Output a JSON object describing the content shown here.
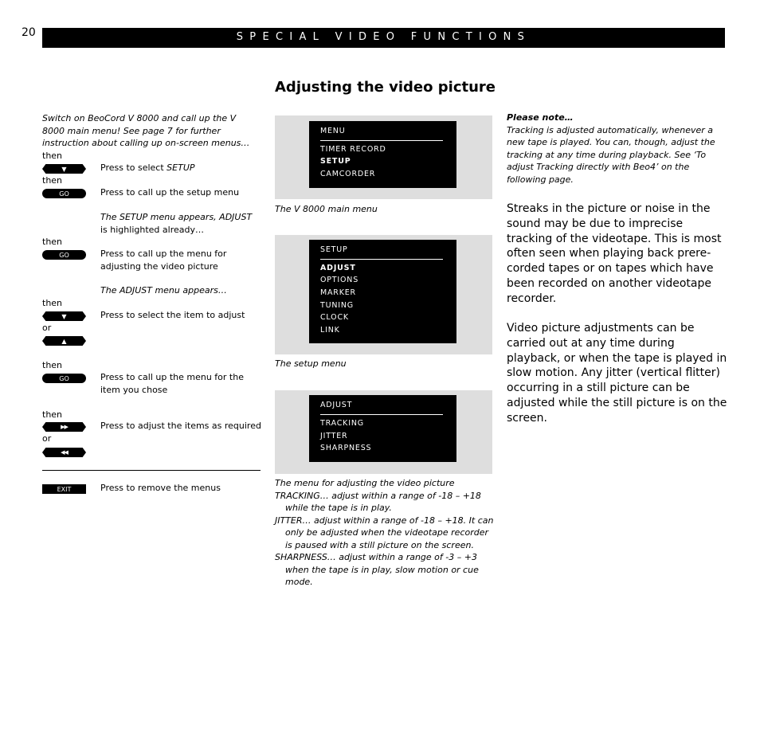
{
  "header": {
    "page_number": "20",
    "section_title": "SPECIAL VIDEO FUNCTIONS"
  },
  "title": "Adjusting the video picture",
  "instructions": {
    "intro": "Switch on BeoCord V 8000 and call up the V 8000 main menu! See page 7 for further instruction about calling up on-screen menus…",
    "connectors": {
      "then": "then",
      "or": "or"
    },
    "steps": [
      {
        "button": "down-arrow",
        "button_label": "▼",
        "text_prefix": "Press to select ",
        "text_italic": "SETUP"
      },
      {
        "button": "go",
        "button_label": "GO",
        "text": "Press to call up the setup menu"
      },
      {
        "note_italic_1": "The SETUP menu appears, ",
        "note_italic_2": "ADJUST",
        "note_rest": " is highlighted already…"
      },
      {
        "button": "go",
        "button_label": "GO",
        "text": "Press to call up the menu for adjusting the video picture"
      },
      {
        "note": "The ADJUST menu appears…"
      },
      {
        "button": "down-arrow",
        "button_label": "▼",
        "text": "Press to select the item to adjust"
      },
      {
        "button": "up-arrow",
        "button_label": "▲"
      },
      {
        "button": "go",
        "button_label": "GO",
        "text": "Press to call up the menu for the item you chose"
      },
      {
        "button": "fast-forward",
        "button_label": "▶▶",
        "text": "Press to adjust the items as required"
      },
      {
        "button": "rewind",
        "button_label": "◀◀"
      },
      {
        "button": "exit",
        "button_label": "EXIT",
        "text": "Press to remove the menus"
      }
    ]
  },
  "menus": [
    {
      "heading": "MENU",
      "items": [
        {
          "label": "TIMER  RECORD",
          "highlighted": false
        },
        {
          "label": "SETUP",
          "highlighted": true
        },
        {
          "label": "CAMCORDER",
          "highlighted": false
        }
      ],
      "caption": "The V 8000 main menu"
    },
    {
      "heading": "SETUP",
      "items": [
        {
          "label": "ADJUST",
          "highlighted": true
        },
        {
          "label": "OPTIONS",
          "highlighted": false
        },
        {
          "label": "MARKER",
          "highlighted": false
        },
        {
          "label": "TUNING",
          "highlighted": false
        },
        {
          "label": "CLOCK",
          "highlighted": false
        },
        {
          "label": "LINK",
          "highlighted": false
        }
      ],
      "caption": "The setup menu"
    },
    {
      "heading": "ADJUST",
      "items": [
        {
          "label": "TRACKING",
          "highlighted": false
        },
        {
          "label": "JITTER",
          "highlighted": false
        },
        {
          "label": "SHARPNESS",
          "highlighted": false
        }
      ],
      "caption": "The menu for adjusting the video picture"
    }
  ],
  "adjust_notes": [
    "TRACKING… adjust within a range of -18 – +18 while the tape is in play.",
    "JITTER… adjust within a range of -18 – +18. It can only be adjusted when the videotape recorder is paused with a still picture on the screen.",
    "SHARPNESS… adjust within a range of -3 – +3 when the tape is in play, slow motion or cue mode."
  ],
  "please_note": {
    "heading": "Please note…",
    "text": "Tracking is adjusted automatically, whenever a new tape is played. You can, though, adjust the tracking at any time during playback. See ‘To adjust Tracking directly with Beo4’ on the following page."
  },
  "body": [
    "Streaks in the picture or noise in the sound may be due to imprecise tracking of the videotape. This is most often seen when playing back prere-corded tapes or on tapes which have been recorded on another videotape recorder.",
    "Video picture adjustments can be carried out at any time during playback, or when the tape is played in slow motion. Any jitter (vertical flitter) occurring in a still picture can be adjusted while the still picture is on the screen."
  ]
}
